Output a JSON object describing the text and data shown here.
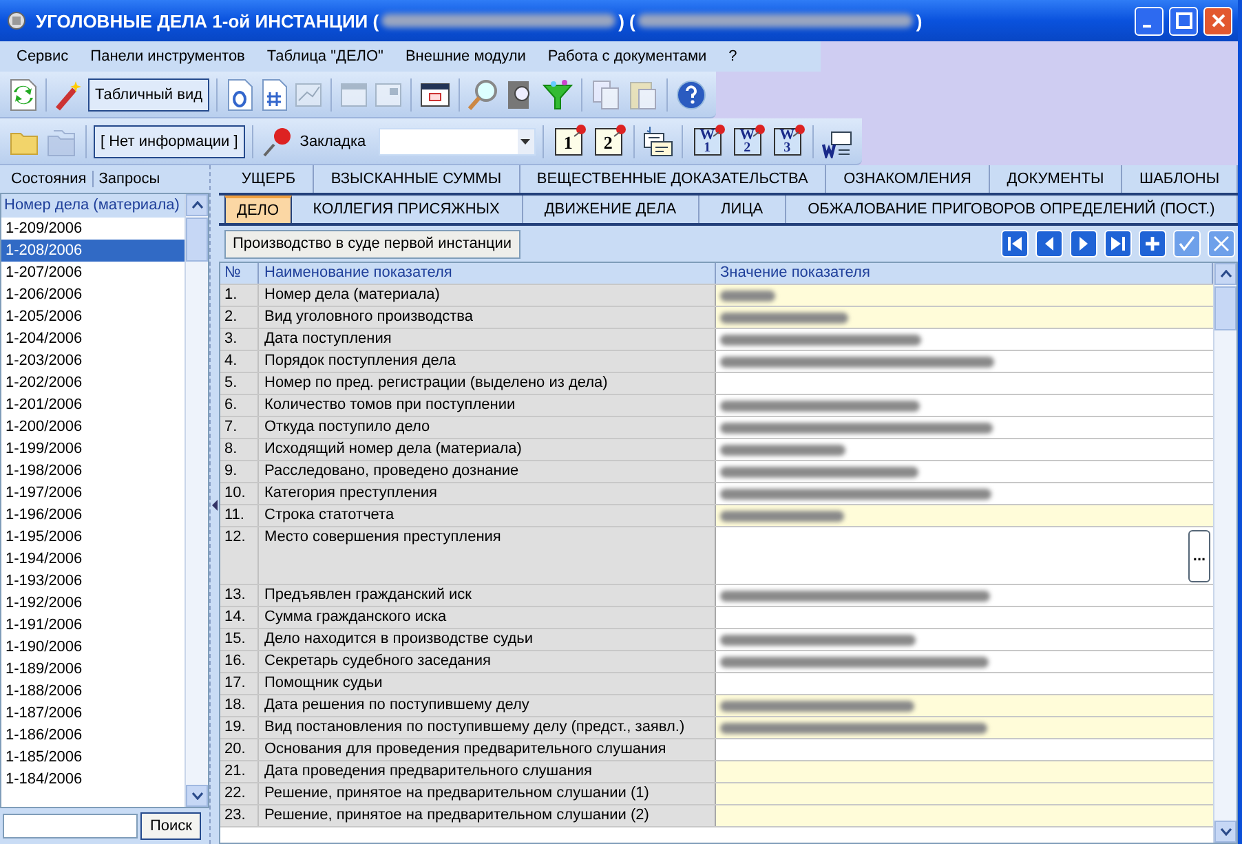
{
  "window": {
    "title_parts": [
      {
        "kind": "text",
        "text": "УГОЛОВНЫЕ ДЕЛА 1-ой ИНСТАНЦИИ ("
      },
      {
        "kind": "redacted"
      },
      {
        "kind": "text",
        "text": ") ("
      },
      {
        "kind": "redacted"
      },
      {
        "kind": "text",
        "text": ")"
      }
    ]
  },
  "menu": [
    "Сервис",
    "Панели инструментов",
    "Таблица \"ДЕЛО\"",
    "Внешние модули",
    "Работа с документами",
    "?"
  ],
  "toolbar1": {
    "view_button": "Табличный вид"
  },
  "toolbar2": {
    "info_field": "[ Нет информации ]",
    "bookmark_label": "Закладка",
    "bookmark_buttons": [
      "1",
      "2"
    ],
    "word_buttons": [
      {
        "letter": "W",
        "number": "1"
      },
      {
        "letter": "W",
        "number": "2"
      },
      {
        "letter": "W",
        "number": "3"
      }
    ]
  },
  "sidebar": {
    "tabs": [
      "Состояния",
      "Запросы"
    ],
    "list_header": "Номер дела (материала)",
    "items": [
      {
        "label": "1-209/2006",
        "selected": false
      },
      {
        "label": "1-208/2006",
        "selected": true
      },
      {
        "label": "1-207/2006",
        "selected": false
      },
      {
        "label": "1-206/2006",
        "selected": false
      },
      {
        "label": "1-205/2006",
        "selected": false
      },
      {
        "label": "1-204/2006",
        "selected": false
      },
      {
        "label": "1-203/2006",
        "selected": false
      },
      {
        "label": "1-202/2006",
        "selected": false
      },
      {
        "label": "1-201/2006",
        "selected": false
      },
      {
        "label": "1-200/2006",
        "selected": false
      },
      {
        "label": "1-199/2006",
        "selected": false
      },
      {
        "label": "1-198/2006",
        "selected": false
      },
      {
        "label": "1-197/2006",
        "selected": false
      },
      {
        "label": "1-196/2006",
        "selected": false
      },
      {
        "label": "1-195/2006",
        "selected": false
      },
      {
        "label": "1-194/2006",
        "selected": false
      },
      {
        "label": "1-193/2006",
        "selected": false
      },
      {
        "label": "1-192/2006",
        "selected": false
      },
      {
        "label": "1-191/2006",
        "selected": false
      },
      {
        "label": "1-190/2006",
        "selected": false
      },
      {
        "label": "1-189/2006",
        "selected": false
      },
      {
        "label": "1-188/2006",
        "selected": false
      },
      {
        "label": "1-187/2006",
        "selected": false
      },
      {
        "label": "1-186/2006",
        "selected": false
      },
      {
        "label": "1-185/2006",
        "selected": false
      },
      {
        "label": "1-184/2006",
        "selected": false
      }
    ],
    "search_button": "Поиск"
  },
  "tabs_row1": [
    {
      "label": "УЩЕРБ",
      "selected": false
    },
    {
      "label": "ВЗЫСКАННЫЕ СУММЫ",
      "selected": false
    },
    {
      "label": "ВЕЩЕСТВЕННЫЕ ДОКАЗАТЕЛЬСТВА",
      "selected": false
    },
    {
      "label": "ОЗНАКОМЛЕНИЯ",
      "selected": false
    },
    {
      "label": "ДОКУМЕНТЫ",
      "selected": false
    },
    {
      "label": "ШАБЛОНЫ",
      "selected": false
    }
  ],
  "tabs_row2": [
    {
      "label": "ДЕЛО",
      "selected": true
    },
    {
      "label": "КОЛЛЕГИЯ ПРИСЯЖНЫХ",
      "selected": false
    },
    {
      "label": "ДВИЖЕНИЕ ДЕЛА",
      "selected": false
    },
    {
      "label": "ЛИЦА",
      "selected": false
    },
    {
      "label": "ОБЖАЛОВАНИЕ ПРИГОВОРОВ ОПРЕДЕЛЕНИЙ (ПОСТ.)",
      "selected": false
    }
  ],
  "section_button": "Производство в суде первой инстанции",
  "table": {
    "columns": [
      "№",
      "Наименование показателя",
      "Значение показателя"
    ],
    "rows": [
      {
        "kind": "text",
        "num": "1.",
        "name": "Номер дела (материала)",
        "highlighted": true,
        "redacted": true
      },
      {
        "kind": "text",
        "num": "2.",
        "name": "Вид уголовного производства",
        "highlighted": true,
        "redacted": true
      },
      {
        "kind": "text",
        "num": "3.",
        "name": "Дата поступления",
        "highlighted": false,
        "redacted": true
      },
      {
        "kind": "text",
        "num": "4.",
        "name": "Порядок поступления дела",
        "highlighted": false,
        "redacted": true
      },
      {
        "kind": "text",
        "num": "5.",
        "name": "Номер по пред. регистрации (выделено из дела)",
        "highlighted": false,
        "redacted": false
      },
      {
        "kind": "text",
        "num": "6.",
        "name": "Количество томов при поступлении",
        "highlighted": false,
        "redacted": true
      },
      {
        "kind": "text",
        "num": "7.",
        "name": "Откуда поступило дело",
        "highlighted": false,
        "redacted": true
      },
      {
        "kind": "text",
        "num": "8.",
        "name": "Исходящий номер дела (материала)",
        "highlighted": false,
        "redacted": true
      },
      {
        "kind": "text",
        "num": "9.",
        "name": "Расследовано, проведено дознание",
        "highlighted": false,
        "redacted": true
      },
      {
        "kind": "text",
        "num": "10.",
        "name": "Категория преступления",
        "highlighted": false,
        "redacted": true
      },
      {
        "kind": "text",
        "num": "11.",
        "name": "Строка статотчета",
        "highlighted": true,
        "redacted": true
      },
      {
        "kind": "multiline",
        "num": "12.",
        "name": "Место совершения преступления",
        "highlighted": false,
        "redacted": false,
        "button": "..."
      },
      {
        "kind": "text",
        "num": "13.",
        "name": "Предъявлен гражданский иск",
        "highlighted": false,
        "redacted": true
      },
      {
        "kind": "text",
        "num": "14.",
        "name": "Сумма гражданского иска",
        "highlighted": false,
        "redacted": false
      },
      {
        "kind": "text",
        "num": "15.",
        "name": "Дело находится в производстве судьи",
        "highlighted": false,
        "redacted": true
      },
      {
        "kind": "text",
        "num": "16.",
        "name": "Секретарь судебного заседания",
        "highlighted": false,
        "redacted": true
      },
      {
        "kind": "text",
        "num": "17.",
        "name": "Помощник судьи",
        "highlighted": false,
        "redacted": false
      },
      {
        "kind": "text",
        "num": "18.",
        "name": "Дата решения по поступившему делу",
        "highlighted": true,
        "redacted": true
      },
      {
        "kind": "text",
        "num": "19.",
        "name": "Вид постановления по поступившему делу (предст., заявл.)",
        "highlighted": true,
        "redacted": true
      },
      {
        "kind": "text",
        "num": "20.",
        "name": "Основания для проведения предварительного слушания",
        "highlighted": false,
        "redacted": false
      },
      {
        "kind": "text",
        "num": "21.",
        "name": "Дата проведения предварительного слушания",
        "highlighted": true,
        "redacted": false
      },
      {
        "kind": "text",
        "num": "22.",
        "name": "Решение, принятое на предварительном слушании (1)",
        "highlighted": true,
        "redacted": false
      },
      {
        "kind": "text",
        "num": "23.",
        "name": "Решение, принятое на предварительном слушании (2)",
        "highlighted": true,
        "redacted": false
      }
    ]
  }
}
